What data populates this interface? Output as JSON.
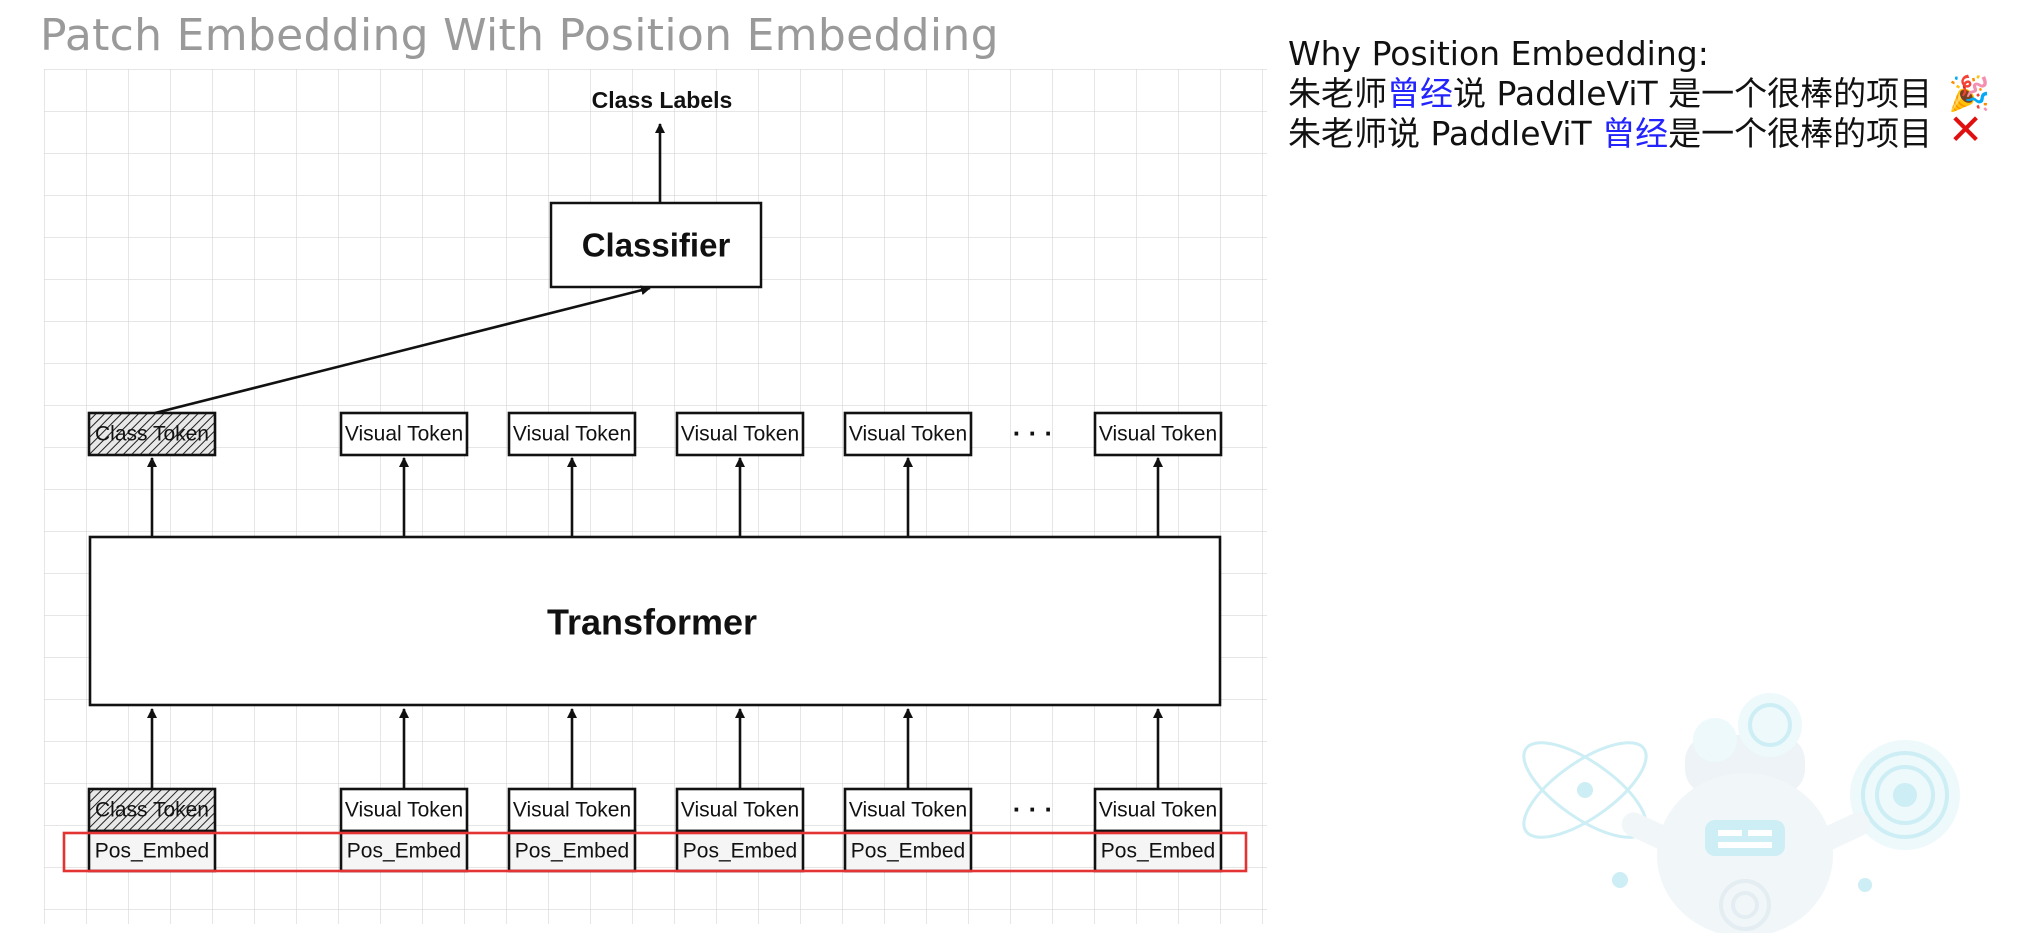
{
  "title": "Patch Embedding With Position Embedding",
  "diagram": {
    "class_labels": "Class Labels",
    "classifier": "Classifier",
    "transformer": "Transformer",
    "class_token": "Class Token",
    "visual_token": "Visual Token",
    "pos_embed": "Pos_Embed",
    "ellipsis": "· · ·",
    "highlight_color": "#e33333"
  },
  "notes": {
    "heading": "Why Position Embedding:",
    "line1": {
      "prefix": "朱老师",
      "highlight": "曾经",
      "suffix": "说 PaddleViT 是一个很棒的项目",
      "mark": "🎉"
    },
    "line2": {
      "prefix": "朱老师说 PaddleViT ",
      "highlight": "曾经",
      "suffix": "是一个很棒的项目",
      "mark": "✕"
    },
    "highlight_color": "#2323ff"
  },
  "decoration": {
    "mascot_icon": "robot-mascot-icon"
  }
}
